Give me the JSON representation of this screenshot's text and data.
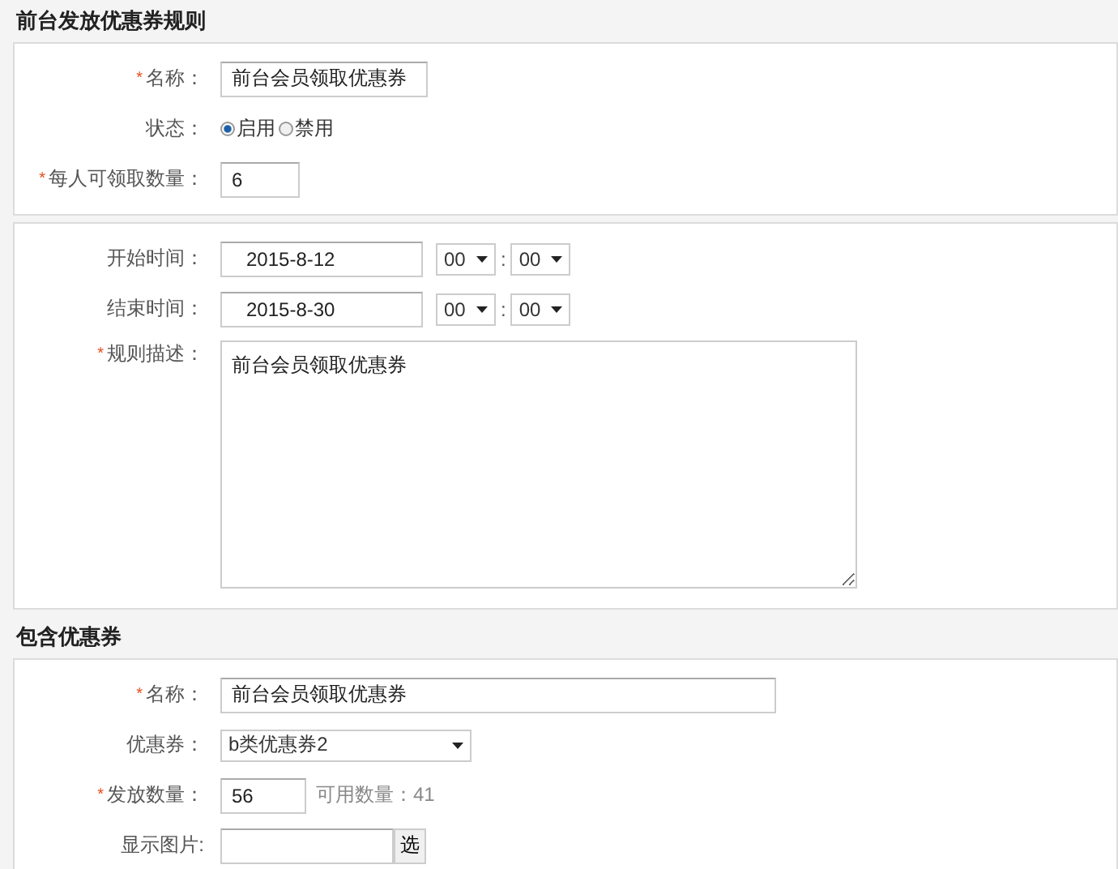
{
  "required_symbol": "*",
  "sections": [
    {
      "title": "前台发放优惠券规则",
      "panels": [
        {
          "rows": [
            {
              "kind": "text",
              "label": "名称：",
              "required": true,
              "value": "前台会员领取优惠券"
            },
            {
              "kind": "radio",
              "label": "状态：",
              "required": false,
              "options": [
                {
                  "label": "启用",
                  "selected": true
                },
                {
                  "label": "禁用",
                  "selected": false
                }
              ]
            },
            {
              "kind": "number",
              "label": "每人可领取数量：",
              "required": true,
              "value": "6"
            }
          ]
        },
        {
          "rows": [
            {
              "kind": "datetime",
              "label": "开始时间：",
              "required": false,
              "value": "2015-8-12",
              "hour": "00",
              "minute": "00",
              "separator": ":"
            },
            {
              "kind": "datetime",
              "label": "结束时间：",
              "required": false,
              "value": "2015-8-30",
              "hour": "00",
              "minute": "00",
              "separator": ":"
            },
            {
              "kind": "textarea",
              "label": "规则描述：",
              "required": true,
              "value": "前台会员领取优惠券"
            }
          ]
        }
      ]
    },
    {
      "title": "包含优惠券",
      "panels": [
        {
          "rows": [
            {
              "kind": "wide-text",
              "label": "名称：",
              "required": true,
              "value": "前台会员领取优惠券"
            },
            {
              "kind": "select",
              "label": "优惠券：",
              "required": false,
              "value": "b类优惠券2"
            },
            {
              "kind": "quantity",
              "label": "发放数量：",
              "required": true,
              "value": "56",
              "note": "可用数量：41"
            },
            {
              "kind": "image",
              "label": "显示图片:",
              "required": false,
              "button": "选"
            }
          ]
        }
      ]
    }
  ]
}
